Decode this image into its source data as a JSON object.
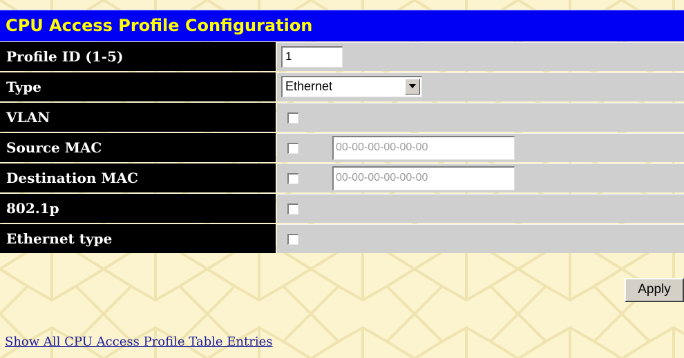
{
  "header": {
    "title": "CPU Access Profile Configuration"
  },
  "form": {
    "rows": [
      {
        "label": "Profile ID (1-5)",
        "control": "textbox",
        "value": "1"
      },
      {
        "label": "Type",
        "control": "select",
        "value": "Ethernet"
      },
      {
        "label": "VLAN",
        "control": "checkbox",
        "checked": false
      },
      {
        "label": "Source MAC",
        "control": "checkbox+text",
        "checked": false,
        "value": "00-00-00-00-00-00"
      },
      {
        "label": "Destination MAC",
        "control": "checkbox+text",
        "checked": false,
        "value": "00-00-00-00-00-00"
      },
      {
        "label": "802.1p",
        "control": "checkbox",
        "checked": false
      },
      {
        "label": "Ethernet type",
        "control": "checkbox",
        "checked": false
      }
    ]
  },
  "actions": {
    "apply_label": "Apply"
  },
  "links": {
    "show_all": "Show All CPU Access Profile Table Entries"
  },
  "colors": {
    "header_bg": "#0000f2",
    "header_text": "#ffff00",
    "label_bg": "#000000",
    "label_text": "#ffffff",
    "value_bg": "#cfcfcf",
    "page_bg": "#fbf4cf",
    "link": "#1a1a9c"
  },
  "icons": {
    "dropdown": "chevron-down-icon"
  }
}
